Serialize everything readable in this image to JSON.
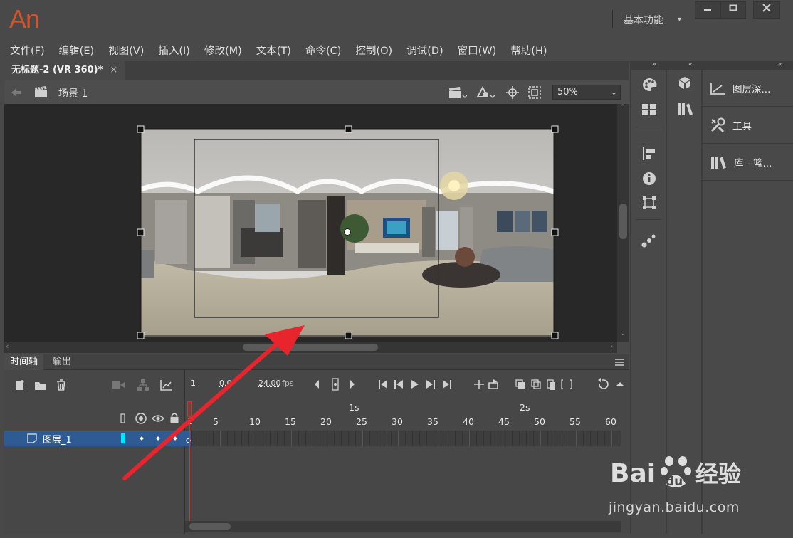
{
  "app": {
    "logo": "An",
    "workspace": "基本功能"
  },
  "menubar": [
    "文件(F)",
    "编辑(E)",
    "视图(V)",
    "插入(I)",
    "修改(M)",
    "文本(T)",
    "命令(C)",
    "控制(O)",
    "调试(D)",
    "窗口(W)",
    "帮助(H)"
  ],
  "document": {
    "tab_title": "无标题-2 (VR 360)*",
    "tab_close": "×",
    "scene": "场景 1",
    "zoom": "50%"
  },
  "timeline": {
    "tab_timeline": "时间轴",
    "tab_output": "输出",
    "current_frame": "1",
    "elapsed": "0.0",
    "fps_value": "24.00",
    "fps_unit": "fps",
    "time_markers": [
      "1s",
      "2s"
    ],
    "ruler_numbers": [
      "1",
      "5",
      "10",
      "15",
      "20",
      "25",
      "30",
      "35",
      "40",
      "45",
      "50",
      "55",
      "60"
    ],
    "layer_name": "图层_1"
  },
  "dock": {
    "panels": [
      "图层深...",
      "工具",
      "库 - 篮..."
    ]
  },
  "watermark": {
    "text": "jingyan.baidu.com",
    "brand_left": "Bai",
    "brand_mid": "du",
    "brand_right": "经验"
  },
  "colors": {
    "logo": "#d1542c",
    "selection": "#2e5b93",
    "playhead": "#c0392b",
    "arrow": "#e8242c"
  }
}
